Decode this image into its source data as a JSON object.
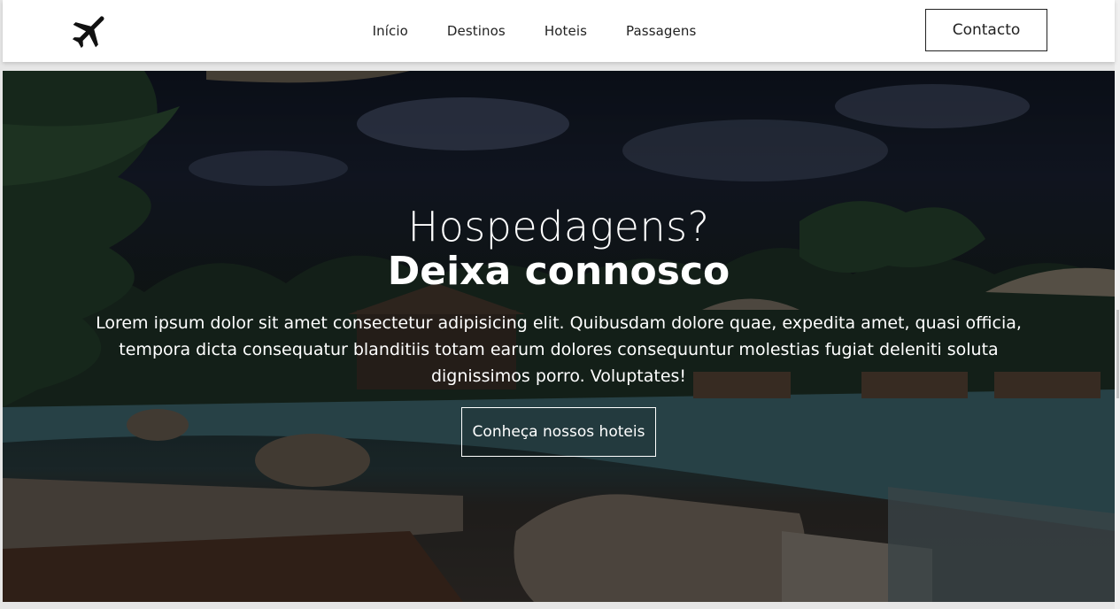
{
  "header": {
    "logo_icon": "airplane-icon",
    "nav": [
      {
        "label": "Início"
      },
      {
        "label": "Destinos"
      },
      {
        "label": "Hoteis"
      },
      {
        "label": "Passagens"
      }
    ],
    "contact_label": "Contacto"
  },
  "hero": {
    "title_line1": "Hospedagens?",
    "title_line2": "Deixa connosco",
    "text": "Lorem ipsum dolor sit amet consectetur adipisicing elit. Quibusdam dolore quae, expedita amet, quasi officia, tempora dicta consequatur blanditiis totam earum dolores consequuntur molestias fugiat deleniti soluta dignissimos porro. Voluptates!",
    "button_label": "Conheça nossos hoteis"
  },
  "colors": {
    "header_bg": "#ffffff",
    "text_dark": "#222222",
    "hero_text": "#ffffff"
  }
}
